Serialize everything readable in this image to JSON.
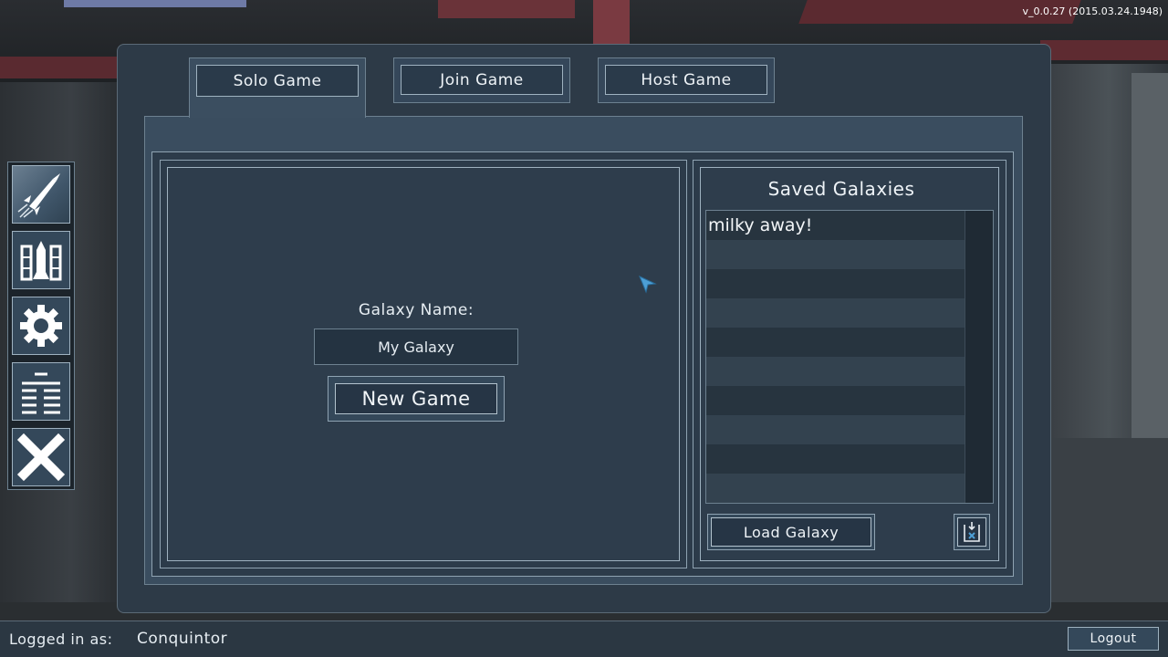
{
  "version": "v_0.0.27 (2015.03.24.1948)",
  "tabs": [
    {
      "label": "Solo Game",
      "active": true
    },
    {
      "label": "Join Game",
      "active": false
    },
    {
      "label": "Host Game",
      "active": false
    }
  ],
  "solo": {
    "galaxy_name_label": "Galaxy Name:",
    "galaxy_name_value": "My Galaxy",
    "new_game_label": "New Game"
  },
  "saved": {
    "title": "Saved Galaxies",
    "items": [
      "milky away!"
    ],
    "load_label": "Load Galaxy",
    "delete_icon": "delete-file-icon"
  },
  "sidenav": {
    "items": [
      {
        "icon": "rocket-launch-icon"
      },
      {
        "icon": "ships-icon"
      },
      {
        "icon": "gear-icon"
      },
      {
        "icon": "list-icon"
      },
      {
        "icon": "close-icon"
      }
    ]
  },
  "footer": {
    "logged_in_label": "Logged in as:",
    "username": "Conquintor",
    "logout_label": "Logout"
  },
  "colors": {
    "panel": "#2d3a47",
    "accent": "#4d9fd6",
    "border": "#9fb2c0"
  }
}
